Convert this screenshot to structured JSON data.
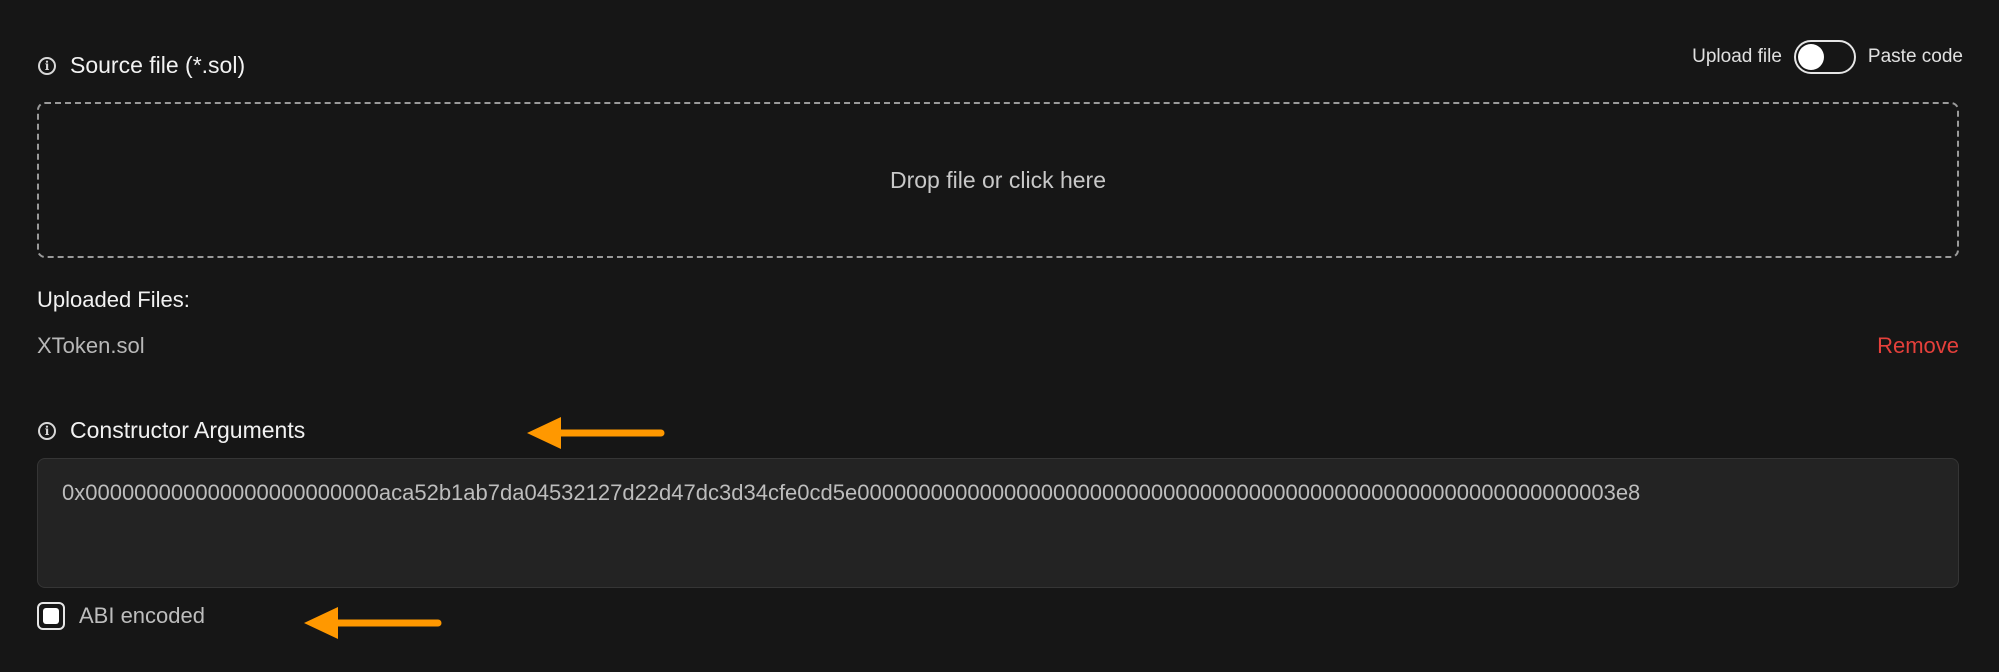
{
  "source_file": {
    "title": "Source file (*.sol)",
    "toggle": {
      "left_label": "Upload file",
      "right_label": "Paste code",
      "state": "upload"
    },
    "dropzone_text": "Drop file or click here"
  },
  "uploaded_files": {
    "label": "Uploaded Files:",
    "files": [
      {
        "name": "XToken.sol",
        "remove_label": "Remove"
      }
    ]
  },
  "constructor_args": {
    "title": "Constructor Arguments",
    "value": "0x000000000000000000000000aca52b1ab7da04532127d22d47dc3d34cfe0cd5e00000000000000000000000000000000000000000000000000000000000003e8"
  },
  "abi_encoded": {
    "label": "ABI encoded",
    "checked": true
  },
  "colors": {
    "background": "#161616",
    "remove": "#e5403b",
    "arrow": "#ff9800"
  },
  "icons": {
    "info": "info-icon",
    "annotation_arrow": "arrow-left-icon"
  }
}
